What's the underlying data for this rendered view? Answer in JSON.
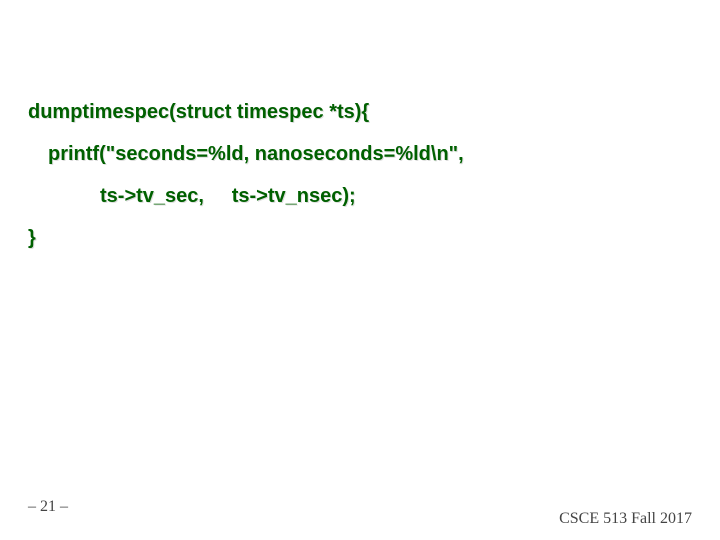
{
  "code": {
    "line1": "dumptimespec(struct timespec *ts){",
    "line2": "printf(\"seconds=%ld, nanoseconds=%ld\\n\",",
    "line3": "ts->tv_sec,     ts->tv_nsec);",
    "line4": "}"
  },
  "footer": {
    "left": "– 21 –",
    "right": "CSCE 513 Fall 2017"
  }
}
